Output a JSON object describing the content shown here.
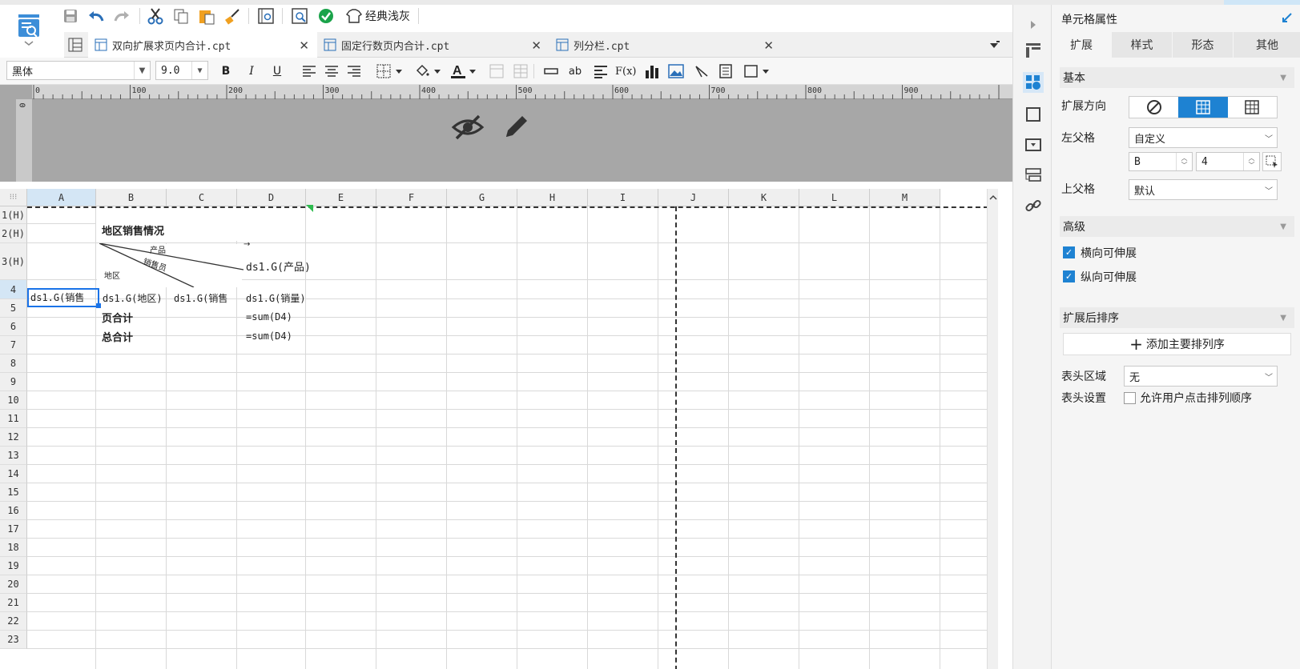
{
  "toolbar": {
    "theme_label": "经典浅灰",
    "font_name": "黑体",
    "font_size": "9.0",
    "bold": "B",
    "italic": "I",
    "underline": "U",
    "formula": "F(x)",
    "text_ab": "ab"
  },
  "tabs": [
    {
      "label": "双向扩展求页内合计.cpt",
      "close": "✕"
    },
    {
      "label": "固定行数页内合计.cpt",
      "close": "✕"
    },
    {
      "label": "列分栏.cpt",
      "close": "✕"
    }
  ],
  "ruler": {
    "ticks": [
      "0",
      "100",
      "200",
      "300",
      "400",
      "500",
      "600",
      "700",
      "800",
      "900"
    ],
    "vtick": "0"
  },
  "columns": [
    "A",
    "B",
    "C",
    "D",
    "E",
    "F",
    "G",
    "H",
    "I",
    "J",
    "K",
    "L",
    "M"
  ],
  "rows": [
    "1(H)",
    "2(H)",
    "3(H)",
    "4",
    "5",
    "6",
    "7",
    "8",
    "9",
    "10",
    "11",
    "12",
    "13",
    "14",
    "15",
    "16",
    "17",
    "18",
    "19",
    "20",
    "21",
    "22",
    "23"
  ],
  "cells": {
    "title": "地区销售情况",
    "diag_product": "产品",
    "diag_salesman": "销售员",
    "diag_region": "地区",
    "d3": "ds1.G(产品)",
    "a4": "ds1.G(销售",
    "b4": "ds1.G(地区)",
    "c4": "ds1.G(销售",
    "d4": "ds1.G(销量)",
    "b5": "页合计",
    "d5": "=sum(D4)",
    "b6": "总合计",
    "d6": "=sum(D4)"
  },
  "panel": {
    "title": "单元格属性",
    "tabs": [
      "扩展",
      "样式",
      "形态",
      "其他"
    ],
    "section_basic": "基本",
    "expand_dir_label": "扩展方向",
    "left_parent_label": "左父格",
    "left_parent_value": "自定义",
    "left_col": "B",
    "left_row": "4",
    "upper_parent_label": "上父格",
    "upper_parent_value": "默认",
    "section_advanced": "高级",
    "h_expand": "横向可伸展",
    "v_expand": "纵向可伸展",
    "section_sort": "扩展后排序",
    "add_sort": "添加主要排列序",
    "header_area_label": "表头区域",
    "header_area_value": "无",
    "header_setting_label": "表头设置",
    "allow_sort": "允许用户点击排列顺序"
  },
  "colors": {
    "accent": "#1e82d2",
    "selection": "#1a73e8",
    "ruler_gray": "#a7a7a7"
  }
}
